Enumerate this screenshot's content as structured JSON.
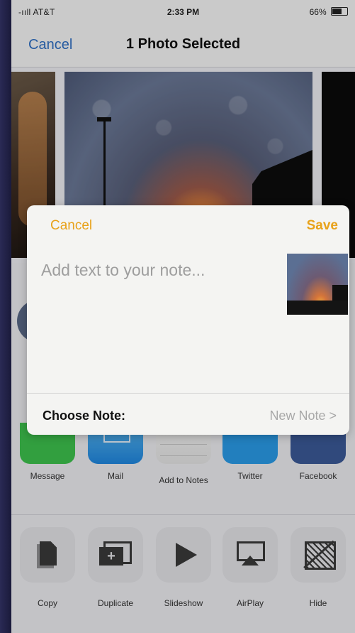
{
  "status_bar": {
    "carrier": "-ııll AT&T",
    "time": "2:33 PM",
    "battery": "66%"
  },
  "nav": {
    "cancel": "Cancel",
    "title": "1 Photo Selected"
  },
  "share_apps": [
    {
      "label": "Message",
      "icon": "message-icon"
    },
    {
      "label": "Mail",
      "icon": "mail-icon"
    },
    {
      "label": "Add to Notes",
      "icon": "notes-icon"
    },
    {
      "label": "Twitter",
      "icon": "twitter-icon"
    },
    {
      "label": "Facebook",
      "icon": "facebook-icon"
    }
  ],
  "actions": [
    {
      "label": "Copy",
      "icon": "copy-icon"
    },
    {
      "label": "Duplicate",
      "icon": "duplicate-icon"
    },
    {
      "label": "Slideshow",
      "icon": "play-icon"
    },
    {
      "label": "AirPlay",
      "icon": "airplay-icon"
    },
    {
      "label": "Hide",
      "icon": "hide-icon"
    }
  ],
  "note_dialog": {
    "cancel": "Cancel",
    "save": "Save",
    "placeholder": "Add text to your note...",
    "value": "",
    "choose_label": "Choose Note:",
    "choose_value": "New Note",
    "chevron": ">"
  },
  "colors": {
    "accent_blue": "#2f6fc4",
    "notes_accent": "#e8a21a"
  }
}
